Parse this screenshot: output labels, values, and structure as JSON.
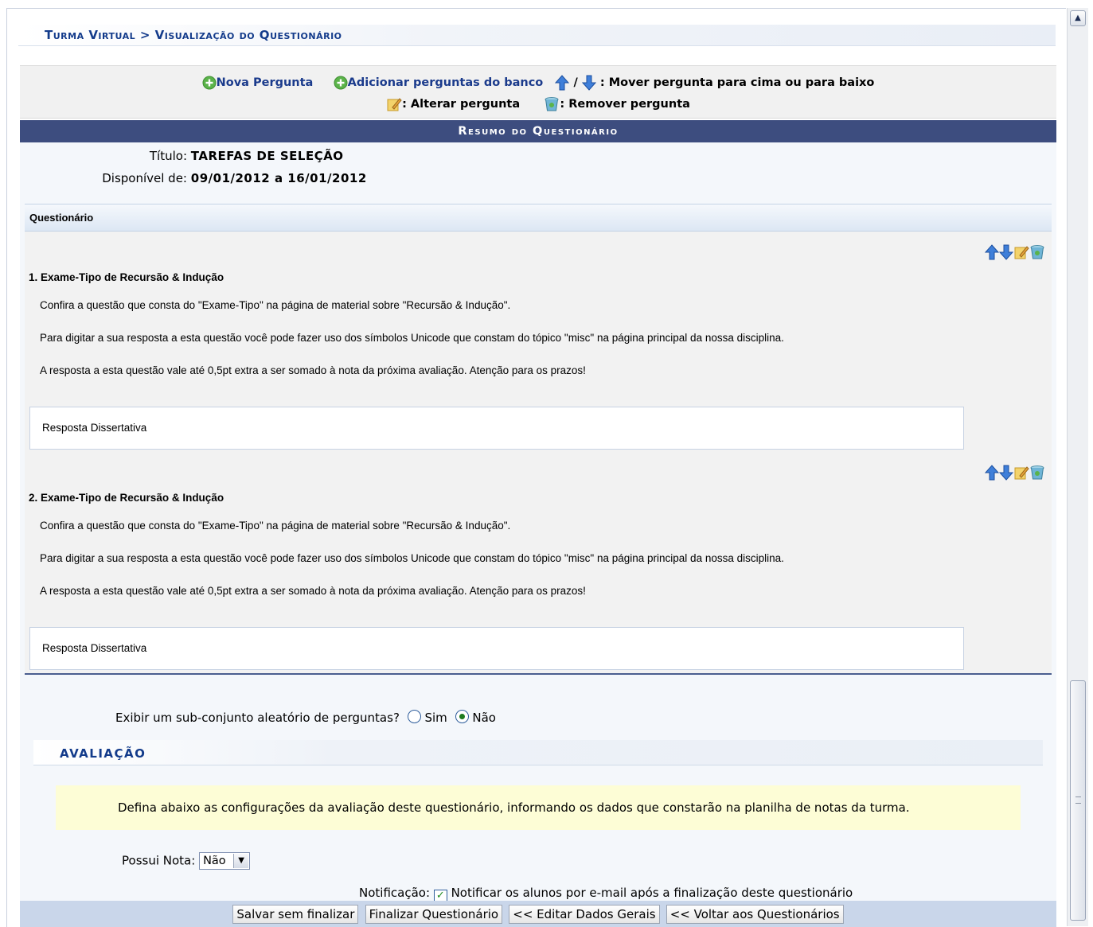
{
  "breadcrumb": "Turma Virtual > Visualização do Questionário",
  "legend": {
    "new_question": "Nova Pergunta",
    "add_from_bank": "Adicionar perguntas do banco",
    "separator": "/",
    "move_text": ": Mover pergunta para cima ou para baixo",
    "edit_text": ": Alterar pergunta",
    "remove_text": ": Remover pergunta"
  },
  "summary": {
    "header": "Resumo do Questionário",
    "title_label": "Título:",
    "title_value": "TAREFAS DE SELEÇÃO",
    "available_label": "Disponível de:",
    "available_value": "09/01/2012 a 16/01/2012"
  },
  "questionnaire": {
    "header": "Questionário",
    "questions": [
      {
        "title": "1. Exame-Tipo de Recursão & Indução",
        "lines": [
          "Confira a questão que consta do \"Exame-Tipo\" na página de material sobre \"Recursão & Indução\".",
          "Para digitar a sua resposta a esta questão você pode fazer uso dos símbolos Unicode que constam do tópico \"misc\" na página principal da nossa disciplina.",
          "A resposta a esta questão vale até 0,5pt extra a ser somado à nota da próxima avaliação.  Atenção para os prazos!"
        ],
        "answer_type": "Resposta Dissertativa"
      },
      {
        "title": "2. Exame-Tipo de Recursão & Indução",
        "lines": [
          "Confira a questão que consta do \"Exame-Tipo\" na página de material sobre \"Recursão & Indução\".",
          "Para digitar a sua resposta a esta questão você pode fazer uso dos símbolos Unicode que constam do tópico \"misc\" na página principal da nossa disciplina.",
          "A resposta a esta questão vale até 0,5pt extra a ser somado à nota da próxima avaliação.  Atenção para os prazos!"
        ],
        "answer_type": "Resposta Dissertativa"
      }
    ]
  },
  "random_subset": {
    "label": "Exibir um sub-conjunto aleatório de perguntas?",
    "option_yes": "Sim",
    "option_no": "Não",
    "selected": "Não"
  },
  "evaluation": {
    "header": "Avaliação",
    "info": "Defina abaixo as configurações da avaliação deste questionário, informando os dados que constarão na planilha de notas da turma.",
    "has_grade_label": "Possui Nota:",
    "has_grade_value": "Não",
    "notification_label": "Notificação:",
    "notification_text": "Notificar os alunos por e-mail após a finalização deste questionário",
    "notification_checked": true
  },
  "buttons": {
    "save": "Salvar sem finalizar",
    "finalize": "Finalizar Questionário",
    "edit_general": "<< Editar Dados Gerais",
    "back": "<< Voltar aos Questionários"
  },
  "icons": {
    "add": "plus-circle-icon",
    "up": "arrow-up-icon",
    "down": "arrow-down-icon",
    "edit": "edit-pencil-icon",
    "remove": "trash-bin-icon"
  },
  "colors": {
    "header_bar": "#3d4d7f",
    "link": "#1b3b8c",
    "info_box": "#fdfdd6",
    "footer": "#c9d6ea"
  }
}
